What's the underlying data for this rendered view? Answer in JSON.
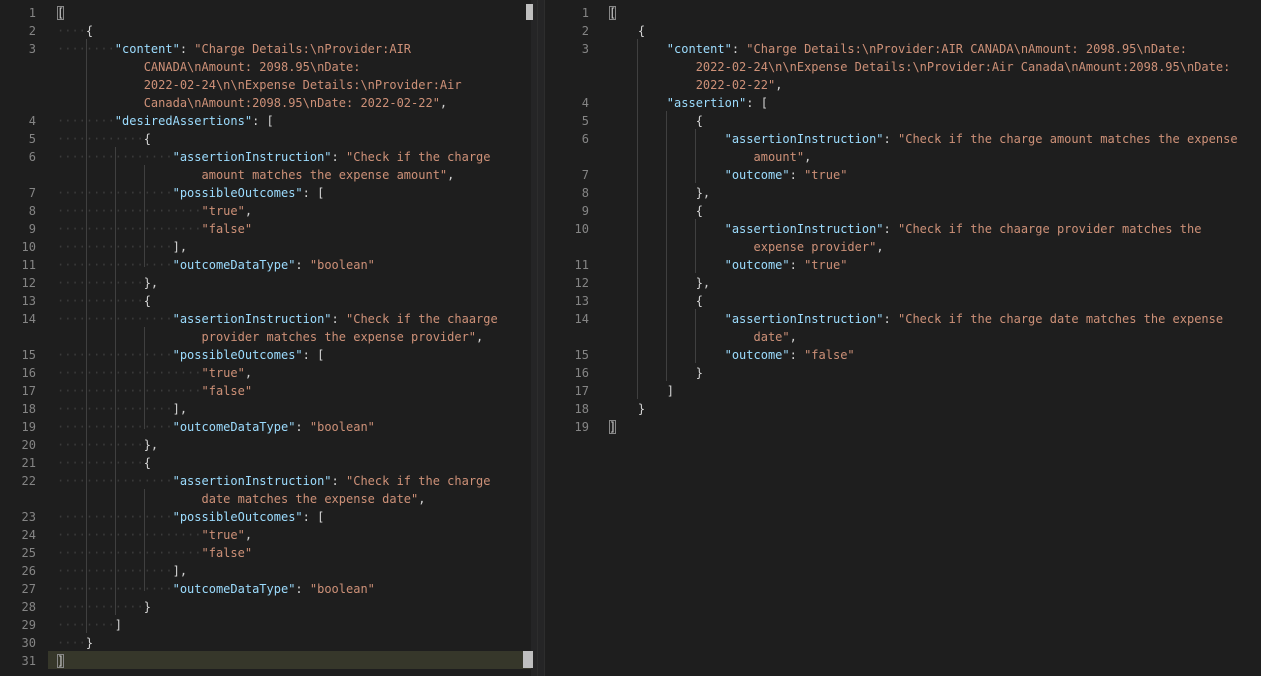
{
  "left_editor": {
    "lines": [
      {
        "n": "1",
        "parts": [
          [
            "brk",
            "["
          ]
        ]
      },
      {
        "n": "2",
        "parts": [
          [
            "ws",
            "····"
          ],
          [
            "pun",
            "{"
          ]
        ]
      },
      {
        "n": "3",
        "parts": [
          [
            "ws",
            "········"
          ],
          [
            "key",
            "\"content\""
          ],
          [
            "pun",
            ": "
          ],
          [
            "str",
            "\"Charge Details:\\nProvider:AIR"
          ]
        ]
      },
      {
        "n": "",
        "parts": [
          [
            "ws",
            "            "
          ],
          [
            "str",
            "CANADA\\nAmount: 2098.95\\nDate:"
          ]
        ]
      },
      {
        "n": "",
        "parts": [
          [
            "ws",
            "            "
          ],
          [
            "str",
            "2022-02-24\\n\\nExpense Details:\\nProvider:Air"
          ]
        ]
      },
      {
        "n": "",
        "parts": [
          [
            "ws",
            "            "
          ],
          [
            "str",
            "Canada\\nAmount:2098.95\\nDate: 2022-02-22\""
          ],
          [
            "pun",
            ","
          ]
        ]
      },
      {
        "n": "4",
        "parts": [
          [
            "ws",
            "········"
          ],
          [
            "key",
            "\"desiredAssertions\""
          ],
          [
            "pun",
            ": ["
          ]
        ]
      },
      {
        "n": "5",
        "parts": [
          [
            "ws",
            "············"
          ],
          [
            "pun",
            "{"
          ]
        ]
      },
      {
        "n": "6",
        "parts": [
          [
            "ws",
            "················"
          ],
          [
            "key",
            "\"assertionInstruction\""
          ],
          [
            "pun",
            ": "
          ],
          [
            "str",
            "\"Check if the charge"
          ]
        ]
      },
      {
        "n": "",
        "parts": [
          [
            "ws",
            "                    "
          ],
          [
            "str",
            "amount matches the expense amount\""
          ],
          [
            "pun",
            ","
          ]
        ]
      },
      {
        "n": "7",
        "parts": [
          [
            "ws",
            "················"
          ],
          [
            "key",
            "\"possibleOutcomes\""
          ],
          [
            "pun",
            ": ["
          ]
        ]
      },
      {
        "n": "8",
        "parts": [
          [
            "ws",
            "····················"
          ],
          [
            "str",
            "\"true\""
          ],
          [
            "pun",
            ","
          ]
        ]
      },
      {
        "n": "9",
        "parts": [
          [
            "ws",
            "····················"
          ],
          [
            "str",
            "\"false\""
          ]
        ]
      },
      {
        "n": "10",
        "parts": [
          [
            "ws",
            "················"
          ],
          [
            "pun",
            "],"
          ]
        ]
      },
      {
        "n": "11",
        "parts": [
          [
            "ws",
            "················"
          ],
          [
            "key",
            "\"outcomeDataType\""
          ],
          [
            "pun",
            ": "
          ],
          [
            "str",
            "\"boolean\""
          ]
        ]
      },
      {
        "n": "12",
        "parts": [
          [
            "ws",
            "············"
          ],
          [
            "pun",
            "},"
          ]
        ]
      },
      {
        "n": "13",
        "parts": [
          [
            "ws",
            "············"
          ],
          [
            "pun",
            "{"
          ]
        ]
      },
      {
        "n": "14",
        "parts": [
          [
            "ws",
            "················"
          ],
          [
            "key",
            "\"assertionInstruction\""
          ],
          [
            "pun",
            ": "
          ],
          [
            "str",
            "\"Check if the chaarge"
          ]
        ]
      },
      {
        "n": "",
        "parts": [
          [
            "ws",
            "                    "
          ],
          [
            "str",
            "provider matches the expense provider\""
          ],
          [
            "pun",
            ","
          ]
        ]
      },
      {
        "n": "15",
        "parts": [
          [
            "ws",
            "················"
          ],
          [
            "key",
            "\"possibleOutcomes\""
          ],
          [
            "pun",
            ": ["
          ]
        ]
      },
      {
        "n": "16",
        "parts": [
          [
            "ws",
            "····················"
          ],
          [
            "str",
            "\"true\""
          ],
          [
            "pun",
            ","
          ]
        ]
      },
      {
        "n": "17",
        "parts": [
          [
            "ws",
            "····················"
          ],
          [
            "str",
            "\"false\""
          ]
        ]
      },
      {
        "n": "18",
        "parts": [
          [
            "ws",
            "················"
          ],
          [
            "pun",
            "],"
          ]
        ]
      },
      {
        "n": "19",
        "parts": [
          [
            "ws",
            "················"
          ],
          [
            "key",
            "\"outcomeDataType\""
          ],
          [
            "pun",
            ": "
          ],
          [
            "str",
            "\"boolean\""
          ]
        ]
      },
      {
        "n": "20",
        "parts": [
          [
            "ws",
            "············"
          ],
          [
            "pun",
            "},"
          ]
        ]
      },
      {
        "n": "21",
        "parts": [
          [
            "ws",
            "············"
          ],
          [
            "pun",
            "{"
          ]
        ]
      },
      {
        "n": "22",
        "parts": [
          [
            "ws",
            "················"
          ],
          [
            "key",
            "\"assertionInstruction\""
          ],
          [
            "pun",
            ": "
          ],
          [
            "str",
            "\"Check if the charge"
          ]
        ]
      },
      {
        "n": "",
        "parts": [
          [
            "ws",
            "                    "
          ],
          [
            "str",
            "date matches the expense date\""
          ],
          [
            "pun",
            ","
          ]
        ]
      },
      {
        "n": "23",
        "parts": [
          [
            "ws",
            "················"
          ],
          [
            "key",
            "\"possibleOutcomes\""
          ],
          [
            "pun",
            ": ["
          ]
        ]
      },
      {
        "n": "24",
        "parts": [
          [
            "ws",
            "····················"
          ],
          [
            "str",
            "\"true\""
          ],
          [
            "pun",
            ","
          ]
        ]
      },
      {
        "n": "25",
        "parts": [
          [
            "ws",
            "····················"
          ],
          [
            "str",
            "\"false\""
          ]
        ]
      },
      {
        "n": "26",
        "parts": [
          [
            "ws",
            "················"
          ],
          [
            "pun",
            "],"
          ]
        ]
      },
      {
        "n": "27",
        "parts": [
          [
            "ws",
            "················"
          ],
          [
            "key",
            "\"outcomeDataType\""
          ],
          [
            "pun",
            ": "
          ],
          [
            "str",
            "\"boolean\""
          ]
        ]
      },
      {
        "n": "28",
        "parts": [
          [
            "ws",
            "············"
          ],
          [
            "pun",
            "}"
          ]
        ]
      },
      {
        "n": "29",
        "parts": [
          [
            "ws",
            "········"
          ],
          [
            "pun",
            "]"
          ]
        ]
      },
      {
        "n": "30",
        "parts": [
          [
            "ws",
            "····"
          ],
          [
            "pun",
            "}"
          ]
        ]
      },
      {
        "n": "31",
        "parts": [
          [
            "brk",
            "]"
          ]
        ]
      }
    ]
  },
  "right_editor": {
    "lines": [
      {
        "n": "1",
        "parts": [
          [
            "brk",
            "["
          ]
        ]
      },
      {
        "n": "2",
        "parts": [
          [
            "ws",
            "    "
          ],
          [
            "pun",
            "{"
          ]
        ]
      },
      {
        "n": "3",
        "parts": [
          [
            "ws",
            "        "
          ],
          [
            "key",
            "\"content\""
          ],
          [
            "pun",
            ": "
          ],
          [
            "str",
            "\"Charge Details:\\nProvider:AIR CANADA\\nAmount: 2098.95\\nDate:"
          ]
        ]
      },
      {
        "n": "",
        "parts": [
          [
            "ws",
            "            "
          ],
          [
            "str",
            "2022-02-24\\n\\nExpense Details:\\nProvider:Air Canada\\nAmount:2098.95\\nDate:"
          ]
        ]
      },
      {
        "n": "",
        "parts": [
          [
            "ws",
            "            "
          ],
          [
            "str",
            "2022-02-22\""
          ],
          [
            "pun",
            ","
          ]
        ]
      },
      {
        "n": "4",
        "parts": [
          [
            "ws",
            "        "
          ],
          [
            "key",
            "\"assertion\""
          ],
          [
            "pun",
            ": ["
          ]
        ]
      },
      {
        "n": "5",
        "parts": [
          [
            "ws",
            "            "
          ],
          [
            "pun",
            "{"
          ]
        ]
      },
      {
        "n": "6",
        "parts": [
          [
            "ws",
            "                "
          ],
          [
            "key",
            "\"assertionInstruction\""
          ],
          [
            "pun",
            ": "
          ],
          [
            "str",
            "\"Check if the charge amount matches the expense"
          ]
        ]
      },
      {
        "n": "",
        "parts": [
          [
            "ws",
            "                    "
          ],
          [
            "str",
            "amount\""
          ],
          [
            "pun",
            ","
          ]
        ]
      },
      {
        "n": "7",
        "parts": [
          [
            "ws",
            "                "
          ],
          [
            "key",
            "\"outcome\""
          ],
          [
            "pun",
            ": "
          ],
          [
            "str",
            "\"true\""
          ]
        ]
      },
      {
        "n": "8",
        "parts": [
          [
            "ws",
            "            "
          ],
          [
            "pun",
            "},"
          ]
        ]
      },
      {
        "n": "9",
        "parts": [
          [
            "ws",
            "            "
          ],
          [
            "pun",
            "{"
          ]
        ]
      },
      {
        "n": "10",
        "parts": [
          [
            "ws",
            "                "
          ],
          [
            "key",
            "\"assertionInstruction\""
          ],
          [
            "pun",
            ": "
          ],
          [
            "str",
            "\"Check if the chaarge provider matches the"
          ]
        ]
      },
      {
        "n": "",
        "parts": [
          [
            "ws",
            "                    "
          ],
          [
            "str",
            "expense provider\""
          ],
          [
            "pun",
            ","
          ]
        ]
      },
      {
        "n": "11",
        "parts": [
          [
            "ws",
            "                "
          ],
          [
            "key",
            "\"outcome\""
          ],
          [
            "pun",
            ": "
          ],
          [
            "str",
            "\"true\""
          ]
        ]
      },
      {
        "n": "12",
        "parts": [
          [
            "ws",
            "            "
          ],
          [
            "pun",
            "},"
          ]
        ]
      },
      {
        "n": "13",
        "parts": [
          [
            "ws",
            "            "
          ],
          [
            "pun",
            "{"
          ]
        ]
      },
      {
        "n": "14",
        "parts": [
          [
            "ws",
            "                "
          ],
          [
            "key",
            "\"assertionInstruction\""
          ],
          [
            "pun",
            ": "
          ],
          [
            "str",
            "\"Check if the charge date matches the expense"
          ]
        ]
      },
      {
        "n": "",
        "parts": [
          [
            "ws",
            "                    "
          ],
          [
            "str",
            "date\""
          ],
          [
            "pun",
            ","
          ]
        ]
      },
      {
        "n": "15",
        "parts": [
          [
            "ws",
            "                "
          ],
          [
            "key",
            "\"outcome\""
          ],
          [
            "pun",
            ": "
          ],
          [
            "str",
            "\"false\""
          ]
        ]
      },
      {
        "n": "16",
        "parts": [
          [
            "ws",
            "            "
          ],
          [
            "pun",
            "}"
          ]
        ]
      },
      {
        "n": "17",
        "parts": [
          [
            "ws",
            "        "
          ],
          [
            "pun",
            "]"
          ]
        ]
      },
      {
        "n": "18",
        "parts": [
          [
            "ws",
            "    "
          ],
          [
            "pun",
            "}"
          ]
        ]
      },
      {
        "n": "19",
        "parts": [
          [
            "brk",
            "]"
          ]
        ]
      }
    ]
  }
}
